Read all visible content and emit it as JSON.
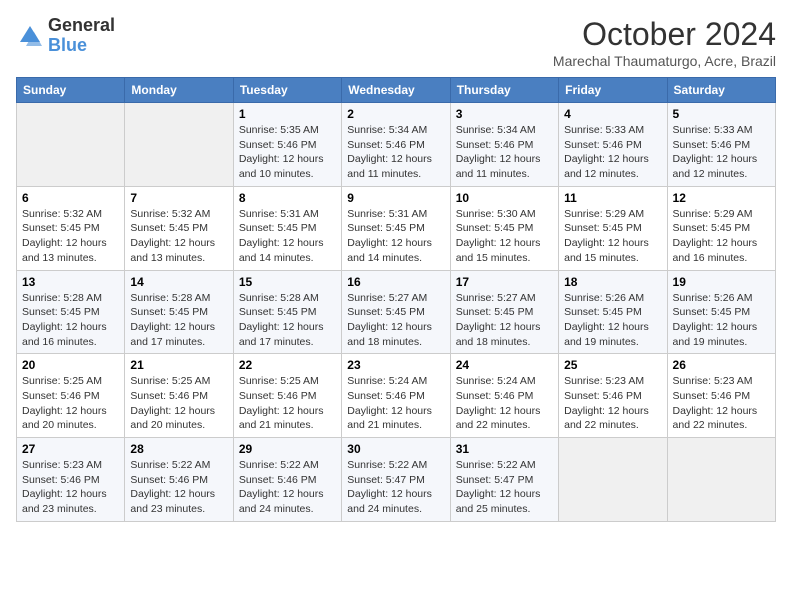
{
  "header": {
    "logo_general": "General",
    "logo_blue": "Blue",
    "month": "October 2024",
    "location": "Marechal Thaumaturgo, Acre, Brazil"
  },
  "days_of_week": [
    "Sunday",
    "Monday",
    "Tuesday",
    "Wednesday",
    "Thursday",
    "Friday",
    "Saturday"
  ],
  "weeks": [
    [
      {
        "day": "",
        "empty": true
      },
      {
        "day": "",
        "empty": true
      },
      {
        "day": "1",
        "sunrise": "Sunrise: 5:35 AM",
        "sunset": "Sunset: 5:46 PM",
        "daylight": "Daylight: 12 hours and 10 minutes."
      },
      {
        "day": "2",
        "sunrise": "Sunrise: 5:34 AM",
        "sunset": "Sunset: 5:46 PM",
        "daylight": "Daylight: 12 hours and 11 minutes."
      },
      {
        "day": "3",
        "sunrise": "Sunrise: 5:34 AM",
        "sunset": "Sunset: 5:46 PM",
        "daylight": "Daylight: 12 hours and 11 minutes."
      },
      {
        "day": "4",
        "sunrise": "Sunrise: 5:33 AM",
        "sunset": "Sunset: 5:46 PM",
        "daylight": "Daylight: 12 hours and 12 minutes."
      },
      {
        "day": "5",
        "sunrise": "Sunrise: 5:33 AM",
        "sunset": "Sunset: 5:46 PM",
        "daylight": "Daylight: 12 hours and 12 minutes."
      }
    ],
    [
      {
        "day": "6",
        "sunrise": "Sunrise: 5:32 AM",
        "sunset": "Sunset: 5:45 PM",
        "daylight": "Daylight: 12 hours and 13 minutes."
      },
      {
        "day": "7",
        "sunrise": "Sunrise: 5:32 AM",
        "sunset": "Sunset: 5:45 PM",
        "daylight": "Daylight: 12 hours and 13 minutes."
      },
      {
        "day": "8",
        "sunrise": "Sunrise: 5:31 AM",
        "sunset": "Sunset: 5:45 PM",
        "daylight": "Daylight: 12 hours and 14 minutes."
      },
      {
        "day": "9",
        "sunrise": "Sunrise: 5:31 AM",
        "sunset": "Sunset: 5:45 PM",
        "daylight": "Daylight: 12 hours and 14 minutes."
      },
      {
        "day": "10",
        "sunrise": "Sunrise: 5:30 AM",
        "sunset": "Sunset: 5:45 PM",
        "daylight": "Daylight: 12 hours and 15 minutes."
      },
      {
        "day": "11",
        "sunrise": "Sunrise: 5:29 AM",
        "sunset": "Sunset: 5:45 PM",
        "daylight": "Daylight: 12 hours and 15 minutes."
      },
      {
        "day": "12",
        "sunrise": "Sunrise: 5:29 AM",
        "sunset": "Sunset: 5:45 PM",
        "daylight": "Daylight: 12 hours and 16 minutes."
      }
    ],
    [
      {
        "day": "13",
        "sunrise": "Sunrise: 5:28 AM",
        "sunset": "Sunset: 5:45 PM",
        "daylight": "Daylight: 12 hours and 16 minutes."
      },
      {
        "day": "14",
        "sunrise": "Sunrise: 5:28 AM",
        "sunset": "Sunset: 5:45 PM",
        "daylight": "Daylight: 12 hours and 17 minutes."
      },
      {
        "day": "15",
        "sunrise": "Sunrise: 5:28 AM",
        "sunset": "Sunset: 5:45 PM",
        "daylight": "Daylight: 12 hours and 17 minutes."
      },
      {
        "day": "16",
        "sunrise": "Sunrise: 5:27 AM",
        "sunset": "Sunset: 5:45 PM",
        "daylight": "Daylight: 12 hours and 18 minutes."
      },
      {
        "day": "17",
        "sunrise": "Sunrise: 5:27 AM",
        "sunset": "Sunset: 5:45 PM",
        "daylight": "Daylight: 12 hours and 18 minutes."
      },
      {
        "day": "18",
        "sunrise": "Sunrise: 5:26 AM",
        "sunset": "Sunset: 5:45 PM",
        "daylight": "Daylight: 12 hours and 19 minutes."
      },
      {
        "day": "19",
        "sunrise": "Sunrise: 5:26 AM",
        "sunset": "Sunset: 5:45 PM",
        "daylight": "Daylight: 12 hours and 19 minutes."
      }
    ],
    [
      {
        "day": "20",
        "sunrise": "Sunrise: 5:25 AM",
        "sunset": "Sunset: 5:46 PM",
        "daylight": "Daylight: 12 hours and 20 minutes."
      },
      {
        "day": "21",
        "sunrise": "Sunrise: 5:25 AM",
        "sunset": "Sunset: 5:46 PM",
        "daylight": "Daylight: 12 hours and 20 minutes."
      },
      {
        "day": "22",
        "sunrise": "Sunrise: 5:25 AM",
        "sunset": "Sunset: 5:46 PM",
        "daylight": "Daylight: 12 hours and 21 minutes."
      },
      {
        "day": "23",
        "sunrise": "Sunrise: 5:24 AM",
        "sunset": "Sunset: 5:46 PM",
        "daylight": "Daylight: 12 hours and 21 minutes."
      },
      {
        "day": "24",
        "sunrise": "Sunrise: 5:24 AM",
        "sunset": "Sunset: 5:46 PM",
        "daylight": "Daylight: 12 hours and 22 minutes."
      },
      {
        "day": "25",
        "sunrise": "Sunrise: 5:23 AM",
        "sunset": "Sunset: 5:46 PM",
        "daylight": "Daylight: 12 hours and 22 minutes."
      },
      {
        "day": "26",
        "sunrise": "Sunrise: 5:23 AM",
        "sunset": "Sunset: 5:46 PM",
        "daylight": "Daylight: 12 hours and 22 minutes."
      }
    ],
    [
      {
        "day": "27",
        "sunrise": "Sunrise: 5:23 AM",
        "sunset": "Sunset: 5:46 PM",
        "daylight": "Daylight: 12 hours and 23 minutes."
      },
      {
        "day": "28",
        "sunrise": "Sunrise: 5:22 AM",
        "sunset": "Sunset: 5:46 PM",
        "daylight": "Daylight: 12 hours and 23 minutes."
      },
      {
        "day": "29",
        "sunrise": "Sunrise: 5:22 AM",
        "sunset": "Sunset: 5:46 PM",
        "daylight": "Daylight: 12 hours and 24 minutes."
      },
      {
        "day": "30",
        "sunrise": "Sunrise: 5:22 AM",
        "sunset": "Sunset: 5:47 PM",
        "daylight": "Daylight: 12 hours and 24 minutes."
      },
      {
        "day": "31",
        "sunrise": "Sunrise: 5:22 AM",
        "sunset": "Sunset: 5:47 PM",
        "daylight": "Daylight: 12 hours and 25 minutes."
      },
      {
        "day": "",
        "empty": true
      },
      {
        "day": "",
        "empty": true
      }
    ]
  ]
}
